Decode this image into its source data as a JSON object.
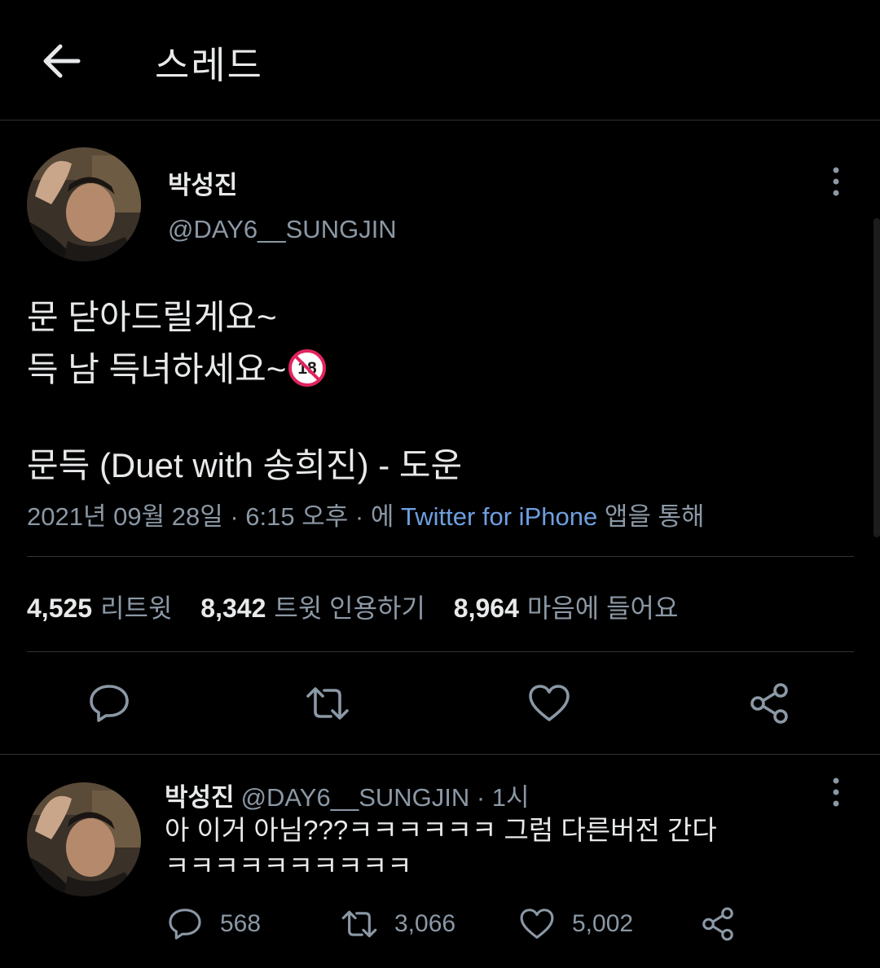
{
  "header": {
    "title": "스레드",
    "back_icon": "arrow-left-icon"
  },
  "tweet": {
    "display_name": "박성진",
    "handle": "@DAY6__SUNGJIN",
    "text_lines": [
      "문 닫아드릴게요~",
      "득 남 득녀하세요~",
      "",
      "문득 (Duet with 송희진) - 도운"
    ],
    "emoji": "18",
    "meta": {
      "date": "2021년 09월 28일",
      "sep1": " · ",
      "time": "6:15 오후",
      "sep2": " · ",
      "via_prefix": "에 ",
      "source": "Twitter for iPhone",
      "via_suffix": " 앱을 통해"
    },
    "stats": {
      "retweets": {
        "value": "4,525",
        "label": "리트윗"
      },
      "quotes": {
        "value": "8,342",
        "label": "트윗 인용하기"
      },
      "likes": {
        "value": "8,964",
        "label": "마음에 들어요"
      }
    },
    "actions": [
      "reply-icon",
      "retweet-icon",
      "heart-icon",
      "share-icon"
    ]
  },
  "reply": {
    "display_name": "박성진",
    "meta": "@DAY6__SUNGJIN · 1시",
    "text_lines": [
      "아 이거 아님???ㅋㅋㅋㅋㅋㅋ 그럼 다른버전 간다",
      "ㅋㅋㅋㅋㅋㅋㅋㅋㅋㅋ"
    ],
    "counts": {
      "replies": "568",
      "retweets": "3,066",
      "likes": "5,002"
    }
  },
  "colors": {
    "background": "#000000",
    "text_primary": "#e7e9ea",
    "text_secondary": "#8b98a5",
    "link": "#6e9fe0",
    "divider": "#2f3336",
    "emoji_red": "#e0245e"
  }
}
